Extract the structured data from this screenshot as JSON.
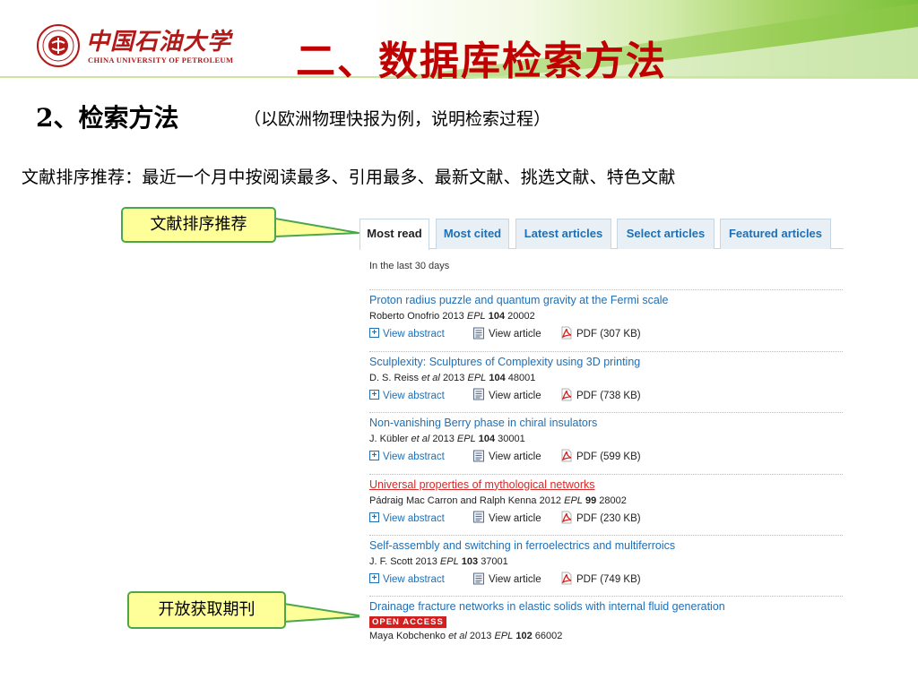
{
  "header": {
    "logo_cn": "中国石油大学",
    "logo_en": "CHINA UNIVERSITY OF PETROLEUM",
    "title": "二、数据库检索方法"
  },
  "section": {
    "heading": "2、检索方法",
    "note": "（以欧洲物理快报为例，说明检索过程）",
    "description": "文献排序推荐：最近一个月中按阅读最多、引用最多、最新文献、挑选文献、特色文献"
  },
  "callouts": {
    "sort_label": "文献排序推荐",
    "open_access_label": "开放获取期刊"
  },
  "web": {
    "tabs": [
      {
        "label": "Most read",
        "active": true
      },
      {
        "label": "Most cited",
        "active": false
      },
      {
        "label": "Latest articles",
        "active": false
      },
      {
        "label": "Select articles",
        "active": false
      },
      {
        "label": "Featured articles",
        "active": false
      }
    ],
    "period": "In the last 30 days",
    "action_labels": {
      "abstract": "View abstract",
      "article": "View article"
    },
    "articles": [
      {
        "title": "Proton radius puzzle and quantum gravity at the Fermi scale",
        "authors": "Roberto Onofrio",
        "et_al": "",
        "year": "2013",
        "journal": "EPL",
        "volume": "104",
        "article_no": "20002",
        "pdf": "PDF (307 KB)",
        "visited": false
      },
      {
        "title": "Sculplexity: Sculptures of Complexity using 3D printing",
        "authors": "D. S. Reiss",
        "et_al": "et al",
        "year": "2013",
        "journal": "EPL",
        "volume": "104",
        "article_no": "48001",
        "pdf": "PDF (738 KB)",
        "visited": false
      },
      {
        "title": "Non-vanishing Berry phase in chiral insulators",
        "authors": "J. Kübler",
        "et_al": "et al",
        "year": "2013",
        "journal": "EPL",
        "volume": "104",
        "article_no": "30001",
        "pdf": "PDF (599 KB)",
        "visited": false
      },
      {
        "title": "Universal properties of mythological networks",
        "authors": "Pádraig Mac Carron and Ralph Kenna",
        "et_al": "",
        "year": "2012",
        "journal": "EPL",
        "volume": "99",
        "article_no": "28002",
        "pdf": "PDF (230 KB)",
        "visited": true
      },
      {
        "title": "Self-assembly and switching in ferroelectrics and multiferroics",
        "authors": "J. F. Scott",
        "et_al": "",
        "year": "2013",
        "journal": "EPL",
        "volume": "103",
        "article_no": "37001",
        "pdf": "PDF (749 KB)",
        "visited": false
      }
    ],
    "last_article": {
      "title": "Drainage fracture networks in elastic solids with internal fluid generation",
      "badge": "OPEN ACCESS",
      "authors": "Maya Kobchenko",
      "et_al": "et al",
      "year": "2013",
      "journal": "EPL",
      "volume": "102",
      "article_no": "66002"
    }
  },
  "colors": {
    "title_red": "#c00000",
    "link_blue": "#1f6fb5",
    "visited_red": "#d42a2a",
    "callout_fill": "#ffff99",
    "callout_border": "#4ca64c",
    "banner_green": "#7cc13a"
  }
}
